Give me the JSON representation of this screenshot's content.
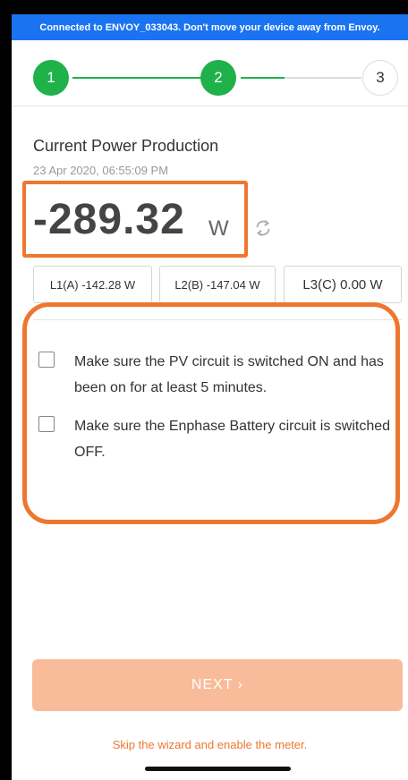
{
  "banner": {
    "text": "Connected to ENVOY_033043. Don't move your device away from Envoy."
  },
  "stepper": {
    "steps": [
      {
        "label": "1",
        "state": "done"
      },
      {
        "label": "2",
        "state": "done"
      },
      {
        "label": "3",
        "state": "pending"
      }
    ]
  },
  "power": {
    "title": "Current Power Production",
    "timestamp": "23 Apr 2020, 06:55:09 PM",
    "value": "-289.32",
    "unit": "W"
  },
  "phases": [
    {
      "label": "L1(A) -142.28 W"
    },
    {
      "label": "L2(B) -147.04 W"
    },
    {
      "label": "L3(C) 0.00 W"
    }
  ],
  "checklist": [
    {
      "text": "Make sure the PV circuit is switched ON and has been on for at least 5 minutes.",
      "checked": false
    },
    {
      "text": "Make sure the Enphase Battery circuit is switched OFF.",
      "checked": false
    }
  ],
  "next_button": {
    "label": "NEXT  ›"
  },
  "skip_link": {
    "label": "Skip the wizard and enable the meter."
  },
  "colors": {
    "banner": "#1a73f0",
    "step_done": "#1fb14a",
    "highlight": "#ee7730",
    "next_disabled": "#f9bc9a"
  }
}
